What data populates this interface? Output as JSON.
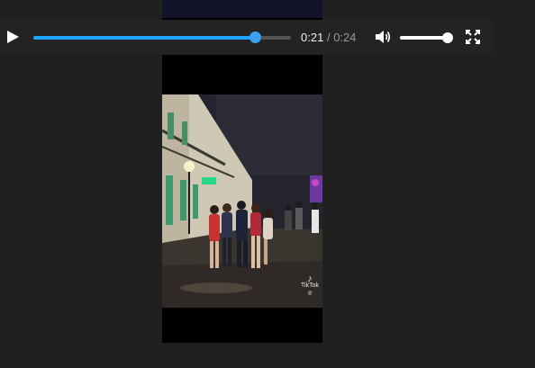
{
  "player": {
    "current_time": "0:21",
    "separator": "/",
    "total_time": "0:24",
    "progress": 0.86,
    "volume": 0.95,
    "accent_color": "#1ea7fd"
  },
  "controls": {
    "play_icon": "play-icon",
    "volume_icon": "volume-icon",
    "fullscreen_icon": "fullscreen-icon"
  },
  "video": {
    "watermark_brand": "TikTok",
    "watermark_user": "@"
  }
}
